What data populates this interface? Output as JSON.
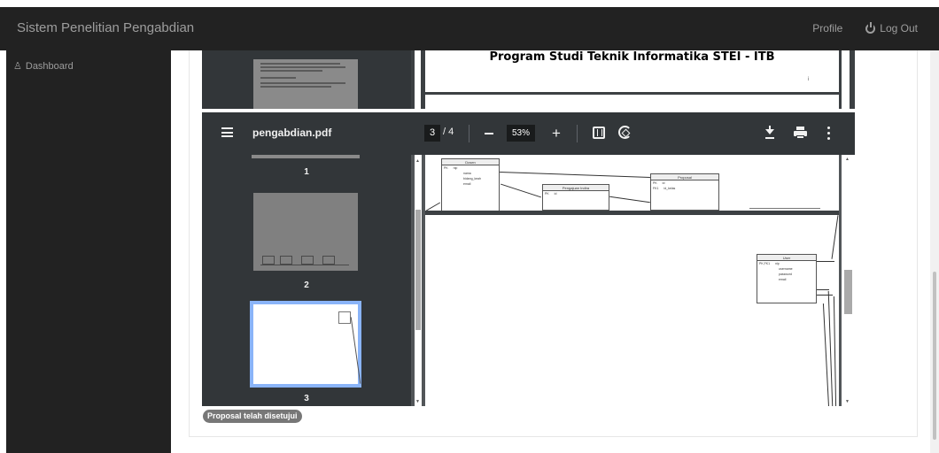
{
  "navbar": {
    "brand": "Sistem Penelitian Pengabdian",
    "profile": "Profile",
    "logout": "Log Out"
  },
  "sidebar": {
    "items": [
      {
        "icon": "dashboard-icon",
        "label": "Dashboard"
      }
    ]
  },
  "background_viewer": {
    "page_heading": "Program Studi Teknik Informatika STEI - ITB",
    "page_number": "i"
  },
  "pdf_viewer": {
    "filename": "pengabdian.pdf",
    "current_page": "3",
    "page_separator": "/",
    "total_pages": "4",
    "zoom": "53%",
    "thumbnails": [
      {
        "label": "1"
      },
      {
        "label": "2"
      },
      {
        "label": "3",
        "selected": true
      }
    ]
  },
  "diagram_top": {
    "dosen": {
      "title": "Dosen",
      "pk": "PK",
      "rows": [
        "nip",
        "nama",
        "bidang_keah",
        "email"
      ]
    },
    "pengajuan": {
      "title": "Pengajuan Indira",
      "pk": "PK",
      "rows": [
        "id"
      ]
    },
    "proposal": {
      "title": "Proposal",
      "pk": "PK",
      "fk": "FK1",
      "rows": [
        "id",
        "id_kelas"
      ]
    }
  },
  "diagram_main": {
    "user": {
      "title": "User",
      "pk": "PK,FK1",
      "rows": [
        "nip",
        "username",
        "password",
        "email"
      ]
    }
  },
  "status_badge": "Proposal telah disetujui",
  "colors": {
    "navbar_bg": "#222222",
    "toolbar_bg": "#323639",
    "selected_thumb_border": "#8ab4f8",
    "badge_bg": "#777777"
  }
}
